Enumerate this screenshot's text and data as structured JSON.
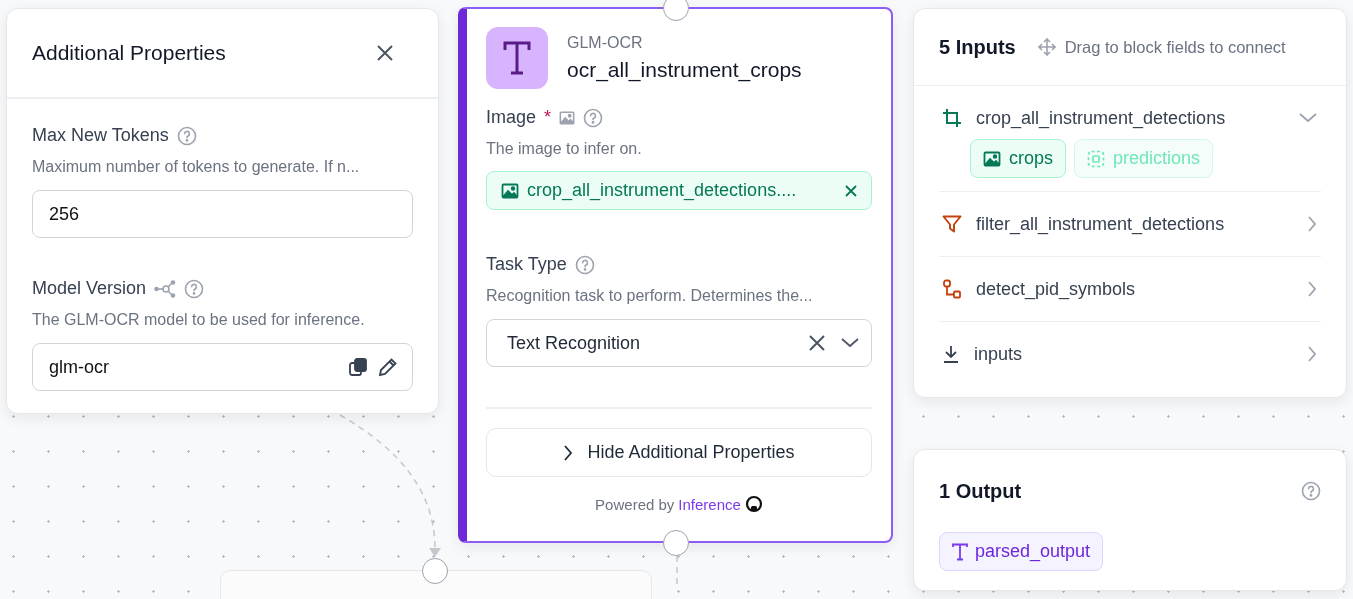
{
  "additional_properties": {
    "title": "Additional Properties",
    "fields": [
      {
        "label": "Max New Tokens",
        "description": "Maximum number of tokens to generate. If n...",
        "value": "256",
        "kind": "number"
      },
      {
        "label": "Model Version",
        "description": "The GLM-OCR model to be used for inference.",
        "value": "glm-ocr",
        "kind": "model"
      }
    ]
  },
  "block": {
    "type": "GLM-OCR",
    "name": "ocr_all_instrument_crops",
    "selected": true,
    "image": {
      "label": "Image",
      "required_mark": "*",
      "description": "The image to infer on.",
      "value": "crop_all_instrument_detections...."
    },
    "task_type": {
      "label": "Task Type",
      "description": "Recognition task to perform. Determines the...",
      "value": "Text Recognition"
    },
    "toggle": "Hide Additional Properties",
    "footer": {
      "prefix": "Powered by",
      "link": "Inference"
    }
  },
  "inputs": {
    "title": "5 Inputs",
    "hint": "Drag to block fields to connect",
    "sources": [
      {
        "name": "crop_all_instrument_detections",
        "kind": "crop",
        "expanded": true,
        "fields": [
          {
            "label": "crops",
            "kind": "image",
            "selected": true
          },
          {
            "label": "predictions",
            "kind": "detections",
            "selected": false
          }
        ]
      },
      {
        "name": "filter_all_instrument_detections",
        "kind": "filter",
        "expanded": false
      },
      {
        "name": "detect_pid_symbols",
        "kind": "model",
        "expanded": false
      },
      {
        "name": "inputs",
        "kind": "input",
        "expanded": false
      }
    ]
  },
  "outputs": {
    "title": "1 Output",
    "items": [
      {
        "label": "parsed_output",
        "kind": "text"
      }
    ]
  }
}
